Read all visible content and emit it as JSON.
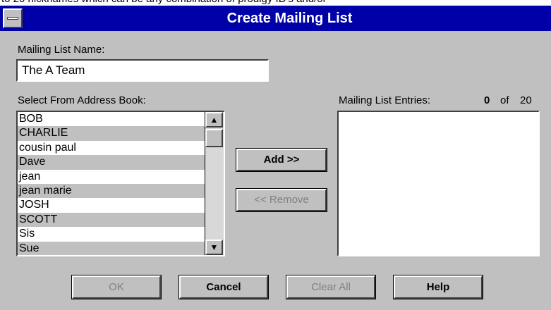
{
  "clipped_header": "to 20 nicknames which can be any combination of prodigy ID's and/or",
  "window": {
    "title": "Create Mailing List"
  },
  "name_field": {
    "label": "Mailing List Name:",
    "value": "The A Team"
  },
  "address_book": {
    "label": "Select From Address Book:",
    "items": [
      "BOB",
      "CHARLIE",
      "cousin paul",
      "Dave",
      "jean",
      "jean marie",
      "JOSH",
      "SCOTT",
      "Sis",
      "Sue"
    ],
    "scroll_up_icon": "arrow-up-icon",
    "scroll_down_icon": "arrow-down-icon"
  },
  "entries": {
    "label": "Mailing List Entries:",
    "count": "0",
    "of_label": "of",
    "max": "20"
  },
  "buttons": {
    "add": "Add >>",
    "remove": "<< Remove",
    "ok": "OK",
    "cancel": "Cancel",
    "clear_all": "Clear All",
    "help": "Help"
  },
  "colors": {
    "titlebar": "#0000a8",
    "dialog_bg": "#c0c0c0",
    "list_alt_row": "#c0c0c0"
  }
}
